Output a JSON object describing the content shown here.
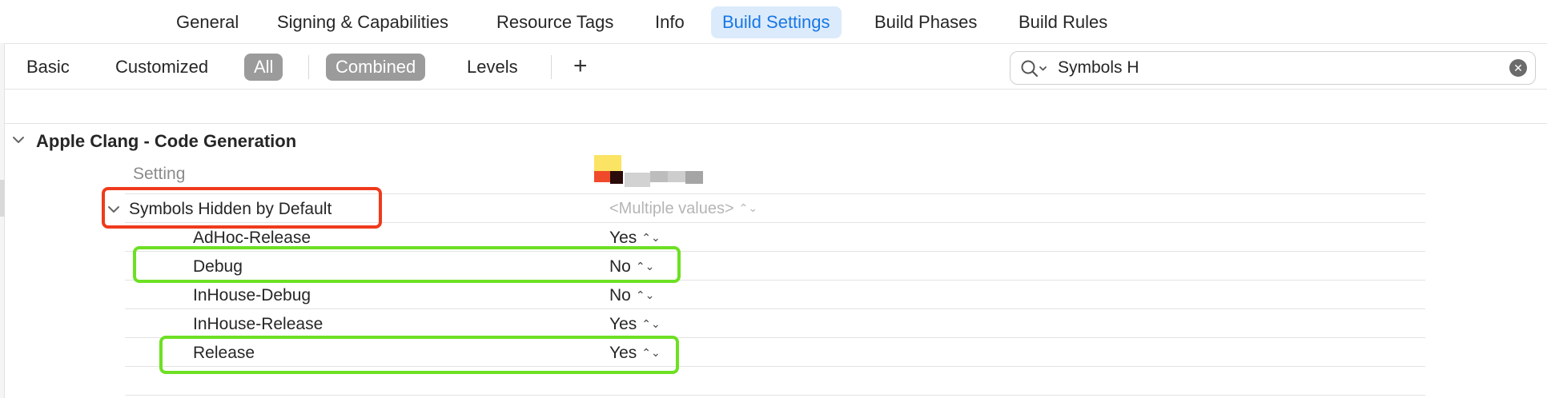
{
  "tabs": [
    {
      "label": "General",
      "active": false
    },
    {
      "label": "Signing & Capabilities",
      "active": false
    },
    {
      "label": "Resource Tags",
      "active": false
    },
    {
      "label": "Info",
      "active": false
    },
    {
      "label": "Build Settings",
      "active": true
    },
    {
      "label": "Build Phases",
      "active": false
    },
    {
      "label": "Build Rules",
      "active": false
    }
  ],
  "filters": {
    "basic": "Basic",
    "customized": "Customized",
    "all": "All",
    "combined": "Combined",
    "levels": "Levels",
    "add": "+"
  },
  "search": {
    "value": "Symbols H",
    "icon": "magnifying-glass-icon",
    "clear_icon": "clear-icon"
  },
  "section": {
    "title": "Apple Clang - Code Generation",
    "column_header": "Setting"
  },
  "setting": {
    "name": "Symbols Hidden by Default",
    "value": "<Multiple values>",
    "stepper": "⌃⌄"
  },
  "rows": [
    {
      "label": "AdHoc-Release",
      "value": "Yes"
    },
    {
      "label": "Debug",
      "value": "No"
    },
    {
      "label": "InHouse-Debug",
      "value": "No"
    },
    {
      "label": "InHouse-Release",
      "value": "Yes"
    },
    {
      "label": "Release",
      "value": "Yes"
    }
  ],
  "colors": {
    "accent": "#1877e6",
    "active_tab_bg": "#dcebfb",
    "pill_bg": "#9b9b9b",
    "highlight_red": "#ef3a1d",
    "highlight_green": "#6de023"
  }
}
